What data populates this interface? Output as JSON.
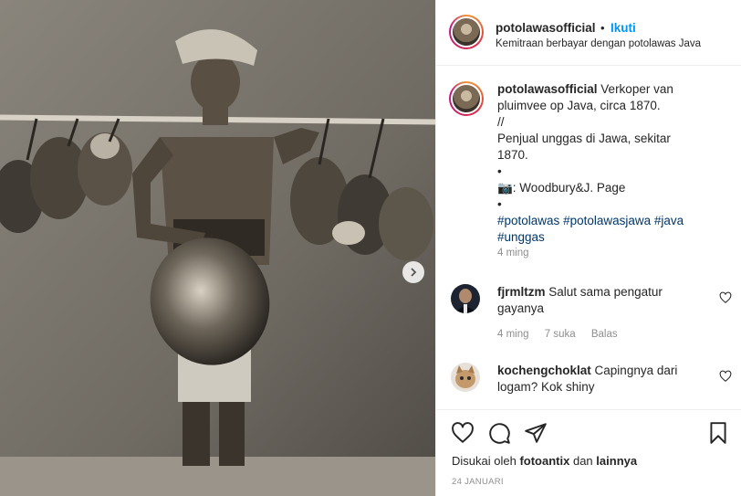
{
  "post": {
    "image_alt": "Verkoper van pluimvee op Java",
    "carousel_next_icon": "chevron-right-icon"
  },
  "header": {
    "username": "potolawasofficial",
    "separator": "•",
    "follow_label": "Ikuti",
    "partnership_text": "Kemitraan berbayar dengan potolawas Java"
  },
  "caption": {
    "username": "potolawasofficial",
    "text": "Verkoper van pluimvee op Java, circa 1870.\n//\nPenjual unggas di Jawa, sekitar 1870.\n•\n📷: Woodbury&J. Page\n•",
    "hashtags": [
      "#potolawas",
      "#potolawasjawa",
      "#java",
      "#unggas"
    ],
    "time": "4 ming"
  },
  "comments": [
    {
      "username": "fjrmltzm",
      "text": "Salut sama pengatur gayanya",
      "time": "4 ming",
      "likes": "7 suka",
      "reply_label": "Balas"
    },
    {
      "username": "kochengchoklat",
      "text": "Capingnya dari logam? Kok shiny"
    }
  ],
  "actions": {
    "like_icon": "heart-icon",
    "comment_icon": "comment-icon",
    "share_icon": "send-icon",
    "save_icon": "bookmark-icon",
    "liked_by_prefix": "Disukai oleh",
    "liked_by_user": "fotoantix",
    "liked_by_conj": "dan",
    "liked_by_others": "lainnya",
    "date": "24 JANUARI"
  }
}
